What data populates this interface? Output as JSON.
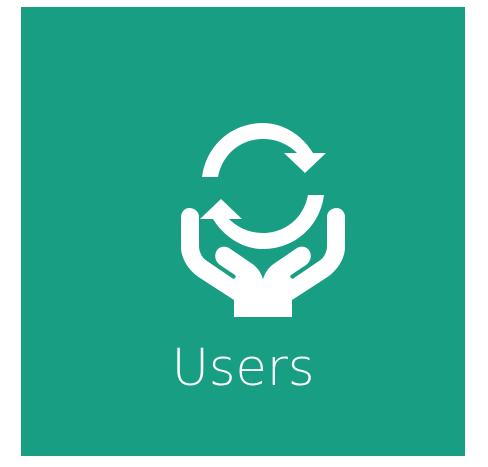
{
  "tile": {
    "label": "Users",
    "icon": "hands-recycle-icon",
    "background_color": "#189e82",
    "foreground_color": "#ffffff"
  }
}
